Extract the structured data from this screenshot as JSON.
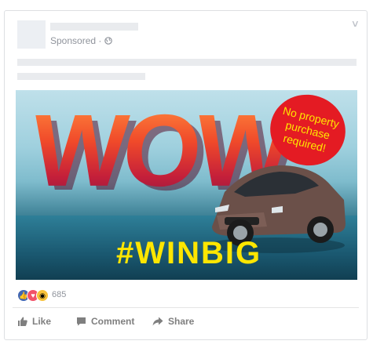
{
  "post": {
    "sponsored_label": "Sponsored · ",
    "globe_icon": "globe-icon",
    "menu_icon": "chevron-down-icon"
  },
  "ad": {
    "headline": "WOW",
    "badge_text": "No property purchase required!",
    "hashtag": "#WINBIG",
    "colors": {
      "badge": "#e41b23",
      "badge_text": "#ffe600",
      "hashtag": "#ffe600"
    }
  },
  "reactions": {
    "icons": [
      "like-reaction-icon",
      "love-reaction-icon",
      "wow-reaction-icon"
    ],
    "count": "685"
  },
  "actions": {
    "like": "Like",
    "comment": "Comment",
    "share": "Share"
  },
  "colors": {
    "brand": "#4267b2",
    "muted": "#90949c"
  }
}
